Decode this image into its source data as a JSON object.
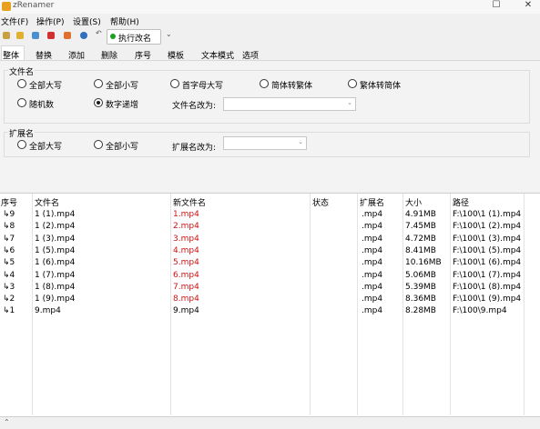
{
  "window": {
    "title": "zRenamer"
  },
  "menu": [
    "文件(F)",
    "操作(P)",
    "设置(S)",
    "帮助(H)"
  ],
  "toolbar": {
    "icons": [
      "settings-icon",
      "folder-open-icon",
      "refresh-icon",
      "delete-icon",
      "edit-icon",
      "info-icon",
      "undo-icon"
    ],
    "run_label": "执行改名",
    "run_color": "#1aa01a"
  },
  "tabs": [
    "整体",
    "替换",
    "添加",
    "删除",
    "序号",
    "模板",
    "文本模式",
    "选项"
  ],
  "filename_group": {
    "title": "文件名",
    "options": [
      "全部大写",
      "全部小写",
      "首字母大写",
      "简体转繁体",
      "繁体转简体",
      "随机数",
      "数字递增"
    ],
    "selected": "数字递增",
    "rename_label": "文件名改为:",
    "rename_value": ""
  },
  "ext_group": {
    "title": "扩展名",
    "options": [
      "全部大写",
      "全部小写"
    ],
    "rename_label": "扩展名改为:",
    "rename_value": ""
  },
  "table": {
    "headers": [
      "序号",
      "文件名",
      "新文件名",
      "状态",
      "扩展名",
      "大小",
      "路径"
    ],
    "rows": [
      {
        "idx": "9",
        "name": "1 (1).mp4",
        "new": "1.mp4",
        "status": "",
        "ext": ".mp4",
        "size": "4.91MB",
        "path": "F:\\100\\1 (1).mp4",
        "changed": true
      },
      {
        "idx": "8",
        "name": "1 (2).mp4",
        "new": "2.mp4",
        "status": "",
        "ext": ".mp4",
        "size": "7.45MB",
        "path": "F:\\100\\1 (2).mp4",
        "changed": true
      },
      {
        "idx": "7",
        "name": "1 (3).mp4",
        "new": "3.mp4",
        "status": "",
        "ext": ".mp4",
        "size": "4.72MB",
        "path": "F:\\100\\1 (3).mp4",
        "changed": true
      },
      {
        "idx": "6",
        "name": "1 (5).mp4",
        "new": "4.mp4",
        "status": "",
        "ext": ".mp4",
        "size": "8.41MB",
        "path": "F:\\100\\1 (5).mp4",
        "changed": true
      },
      {
        "idx": "5",
        "name": "1 (6).mp4",
        "new": "5.mp4",
        "status": "",
        "ext": ".mp4",
        "size": "10.16MB",
        "path": "F:\\100\\1 (6).mp4",
        "changed": true
      },
      {
        "idx": "4",
        "name": "1 (7).mp4",
        "new": "6.mp4",
        "status": "",
        "ext": ".mp4",
        "size": "5.06MB",
        "path": "F:\\100\\1 (7).mp4",
        "changed": true
      },
      {
        "idx": "3",
        "name": "1 (8).mp4",
        "new": "7.mp4",
        "status": "",
        "ext": ".mp4",
        "size": "5.39MB",
        "path": "F:\\100\\1 (8).mp4",
        "changed": true
      },
      {
        "idx": "2",
        "name": "1 (9).mp4",
        "new": "8.mp4",
        "status": "",
        "ext": ".mp4",
        "size": "8.36MB",
        "path": "F:\\100\\1 (9).mp4",
        "changed": true
      },
      {
        "idx": "1",
        "name": "9.mp4",
        "new": "9.mp4",
        "status": "",
        "ext": ".mp4",
        "size": "8.28MB",
        "path": "F:\\100\\9.mp4",
        "changed": false
      }
    ],
    "changed_color": "#d01010"
  }
}
